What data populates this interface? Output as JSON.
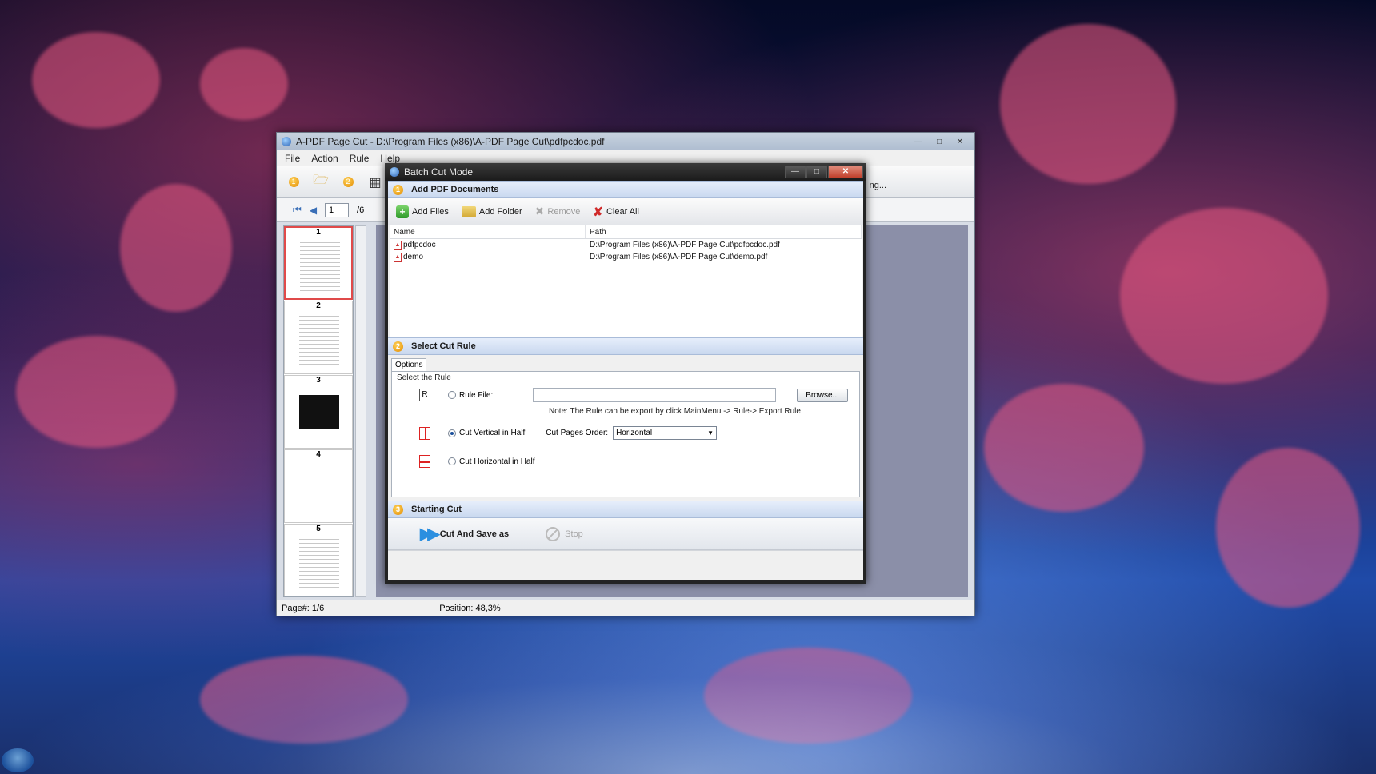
{
  "main_window": {
    "title": "A-PDF Page Cut - D:\\Program Files (x86)\\A-PDF Page Cut\\pdfpcdoc.pdf",
    "menu": [
      "File",
      "Action",
      "Rule",
      "Help"
    ],
    "toolbar_hint": "ng...",
    "nav": {
      "page_value": "1",
      "page_total": "/6"
    },
    "thumbnails": [
      "1",
      "2",
      "3",
      "4",
      "5"
    ],
    "status": {
      "page": "Page#: 1/6",
      "position": "Position: 48,3%"
    },
    "icons": {
      "app": "app-icon",
      "open": "open-folder-icon",
      "grid": "grid-icon"
    }
  },
  "dialog": {
    "title": "Batch Cut Mode",
    "step1": {
      "badge": "1",
      "title": "Add PDF Documents",
      "buttons": {
        "add_files": "Add Files",
        "add_folder": "Add Folder",
        "remove": "Remove",
        "clear_all": "Clear All"
      },
      "columns": {
        "name": "Name",
        "path": "Path"
      },
      "files": [
        {
          "name": "pdfpcdoc",
          "path": "D:\\Program Files (x86)\\A-PDF Page Cut\\pdfpcdoc.pdf"
        },
        {
          "name": "demo",
          "path": "D:\\Program Files (x86)\\A-PDF Page Cut\\demo.pdf"
        }
      ]
    },
    "step2": {
      "badge": "2",
      "title": "Select Cut Rule",
      "tab": "Options",
      "group": "Select the Rule",
      "rule_file": {
        "icon_letter": "R",
        "label": "Rule File:",
        "value": "",
        "browse": "Browse..."
      },
      "note": "Note: The Rule can be export by click MainMenu -> Rule-> Export Rule",
      "cut_vertical": {
        "label": "Cut Vertical in Half",
        "selected": true
      },
      "cut_pages_order": {
        "label": "Cut Pages Order:",
        "value": "Horizontal"
      },
      "cut_horizontal": {
        "label": "Cut Horizontal in Half",
        "selected": false
      }
    },
    "step3": {
      "badge": "3",
      "title": "Starting Cut",
      "cut_and_save": "Cut And Save as",
      "stop": "Stop"
    }
  }
}
